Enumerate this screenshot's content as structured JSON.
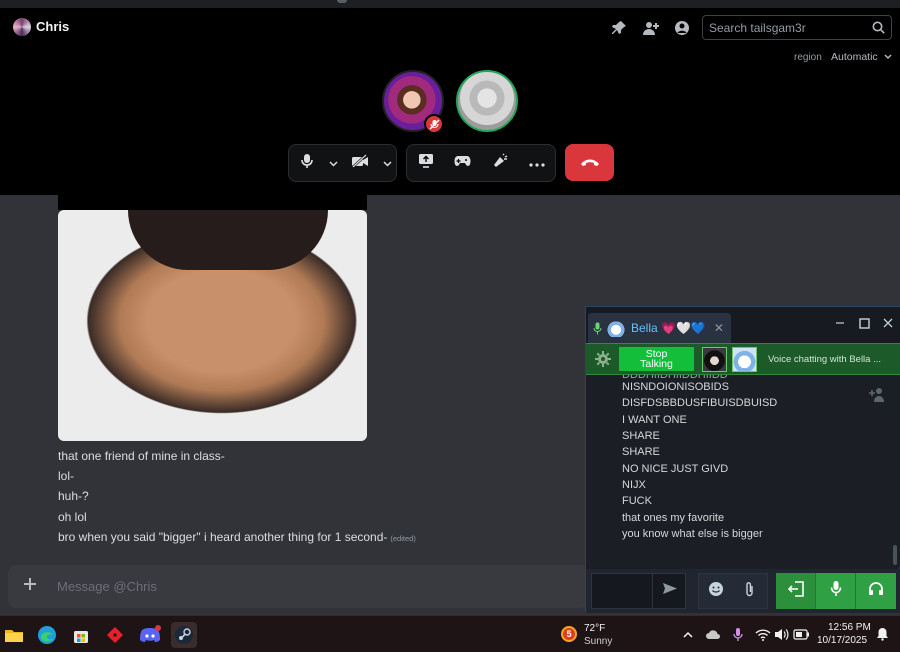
{
  "discord": {
    "dm_name": "Chris",
    "search_placeholder": "Search tailsgam3r",
    "region_label": "region",
    "region_value": "Automatic",
    "messages": [
      "that one friend of mine in class-",
      "lol-",
      "huh-?",
      "oh lol",
      "bro when you said \"bigger\" i heard another thing for 1 second-"
    ],
    "edited_label": "(edited)",
    "composer_placeholder": "Message @Chris",
    "colors": {
      "end_call": "#da373c",
      "speaking_ring": "#23a559"
    }
  },
  "steam": {
    "tab_name": "Bella 💗🤍💙",
    "stop_label_line1": "Stop",
    "stop_label_line2": "Talking",
    "voice_status": "Voice chatting with Bella ...",
    "chat_lines": [
      "NISNDOIONISOBIDS",
      "DISFDSBBDUSFIBUISDBUISD",
      "I WANT ONE",
      "SHARE",
      "SHARE",
      "NO NICE JUST GIVD",
      "NIJX",
      "FUCK",
      "that ones my favorite",
      "you know what else is bigger"
    ],
    "colors": {
      "accent": "#13bf3a",
      "name": "#67c1f5"
    }
  },
  "taskbar": {
    "weather_badge": "5",
    "weather_temp": "72°F",
    "weather_desc": "Sunny",
    "time": "12:56 PM",
    "date": "10/17/2025",
    "apps": [
      "file-explorer-icon",
      "edge-icon",
      "store-icon",
      "roblox-icon",
      "discord-icon",
      "steam-icon"
    ]
  }
}
